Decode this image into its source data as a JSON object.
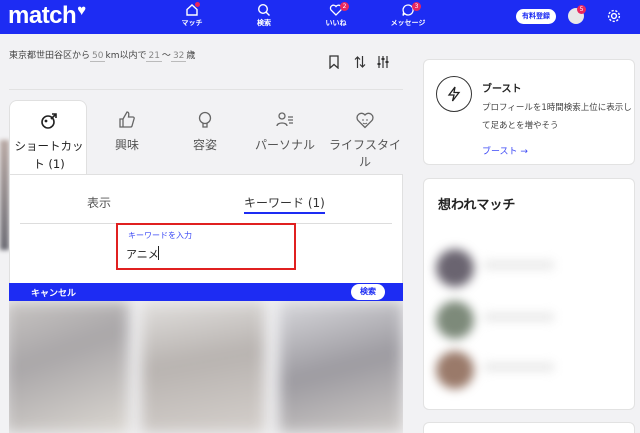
{
  "header": {
    "logo": "match",
    "nav": [
      {
        "label": "マッチ",
        "icon": "home-icon",
        "badge": ""
      },
      {
        "label": "検索",
        "icon": "search-icon",
        "badge": ""
      },
      {
        "label": "いいね",
        "icon": "heart-icon",
        "badge": "2"
      },
      {
        "label": "メッセージ",
        "icon": "message-icon",
        "badge": "3"
      }
    ],
    "premium_label": "有料登録",
    "avatar_badge": "5"
  },
  "search_summary": {
    "location": "東京都世田谷区",
    "from_text": "から",
    "distance": "50",
    "distance_unit": "km以内で",
    "age_min": "21",
    "range_sep": "〜",
    "age_max": "32",
    "age_unit": "歳"
  },
  "filter_tabs": [
    {
      "label": "ショートカット (1)",
      "icon": "bolt-hand-icon",
      "active": true
    },
    {
      "label": "興味",
      "icon": "thumbs-up-icon"
    },
    {
      "label": "容姿",
      "icon": "lightbulb-icon"
    },
    {
      "label": "パーソナル",
      "icon": "person-list-icon"
    },
    {
      "label": "ライフスタイル",
      "icon": "heart-face-icon"
    }
  ],
  "subtabs": {
    "display": "表示",
    "keyword": "キーワード (1)"
  },
  "keyword": {
    "label": "キーワードを入力",
    "value": "アニメ"
  },
  "actions": {
    "cancel": "キャンセル",
    "search": "検索"
  },
  "boost": {
    "title": "ブースト",
    "description": "プロフィールを1時間検索上位に表示して足あとを増やそう",
    "link": "ブースト →"
  },
  "recommended": {
    "title": "想われマッチ"
  },
  "colors": {
    "brand": "#1d2cf3",
    "badge": "#e8265e",
    "highlight": "#e02020",
    "link": "#3b48f5"
  }
}
